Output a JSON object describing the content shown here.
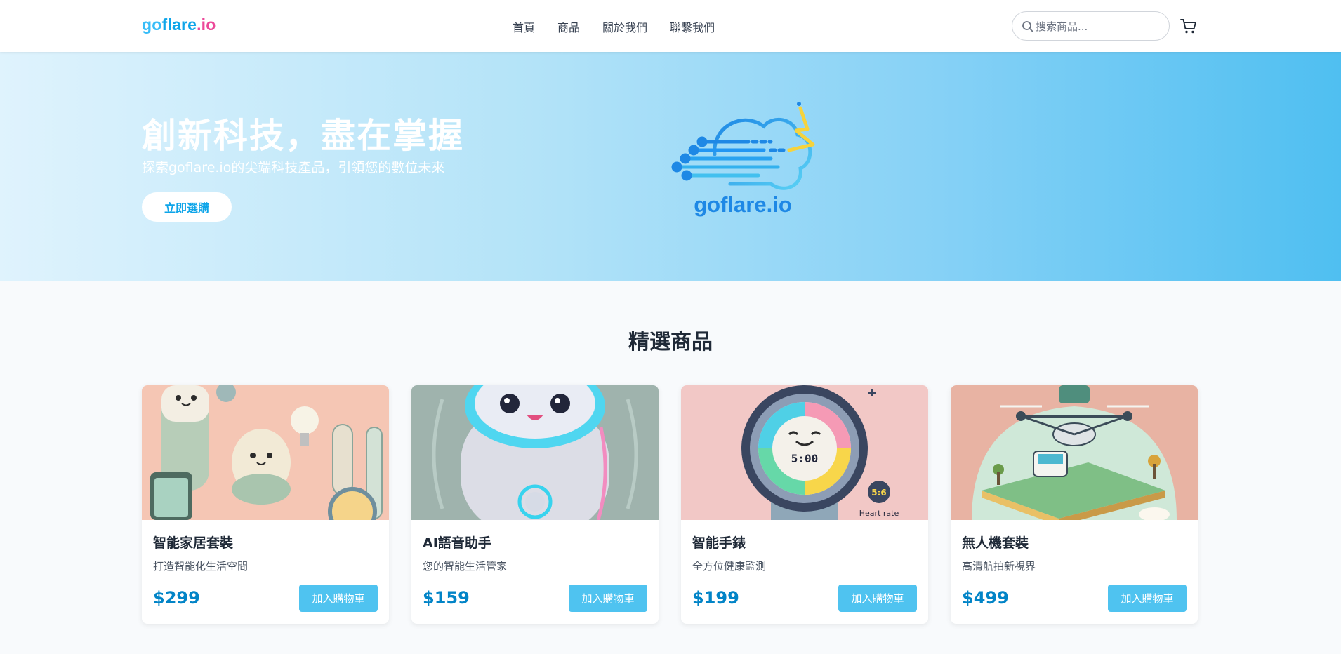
{
  "header": {
    "logo_parts": {
      "go": "go",
      "flare": "flare",
      "io": ".io"
    },
    "nav": [
      {
        "label": "首頁"
      },
      {
        "label": "商品"
      },
      {
        "label": "關於我們"
      },
      {
        "label": "聯繫我們"
      }
    ],
    "search": {
      "placeholder": "搜索商品...",
      "icon": "search-icon"
    },
    "cart": {
      "icon": "cart-icon"
    }
  },
  "hero": {
    "title": "創新科技，盡在掌握",
    "subtitle": "探索goflare.io的尖端科技產品，引領您的數位未來",
    "cta_label": "立即選購",
    "logo_text": "goflare.io"
  },
  "featured": {
    "title": "精選商品",
    "products": [
      {
        "name": "智能家居套裝",
        "desc": "打造智能化生活空間",
        "price": "$299",
        "button": "加入購物車"
      },
      {
        "name": "AI語音助手",
        "desc": "您的智能生活管家",
        "price": "$159",
        "button": "加入購物車"
      },
      {
        "name": "智能手錶",
        "desc": "全方位健康監測",
        "price": "$199",
        "button": "加入購物車"
      },
      {
        "name": "無人機套裝",
        "desc": "高清航拍新視界",
        "price": "$499",
        "button": "加入購物車"
      }
    ]
  },
  "colors": {
    "accent": "#4fc3f0",
    "price": "#0284c7",
    "logo_pink": "#ec4899"
  }
}
